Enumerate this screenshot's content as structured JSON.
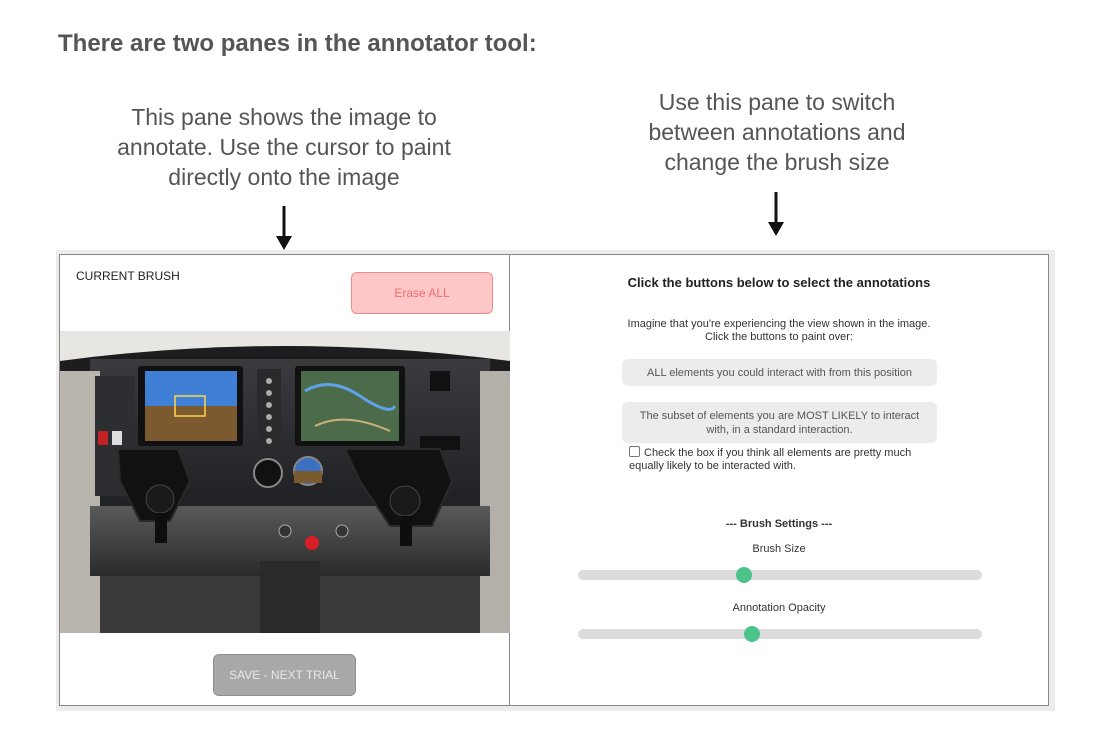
{
  "heading": "There are two panes in the annotator tool:",
  "captions": {
    "left": "This pane shows the image to\nannotate. Use the cursor to paint\ndirectly onto the image",
    "right": "Use this pane to switch\nbetween annotations and\nchange the brush size"
  },
  "left_pane": {
    "brush_label": "CURRENT BRUSH",
    "erase_label": "Erase ALL",
    "save_label": "SAVE - NEXT TRIAL"
  },
  "right_pane": {
    "title": "Click the buttons below to select the annotations",
    "instruction": "Imagine that you're experiencing the view shown in the image.\nClick the buttons to paint over:",
    "button_all": "ALL elements you could interact with from this position",
    "button_likely": "The subset of elements you are MOST LIKELY to interact with, in a standard interaction.",
    "checkbox_text": "Check the box if you think all elements are pretty much equally likely to be interacted with.",
    "checkbox_checked": false,
    "brush_settings_heading": "--- Brush Settings ---",
    "brush_size_label": "Brush Size",
    "brush_size_value": 0.41,
    "opacity_label": "Annotation Opacity",
    "opacity_value": 0.43
  },
  "colors": {
    "erase_bg": "#ffc7c7",
    "erase_text": "#f06d6d",
    "save_bg": "#a8a8a8",
    "slider_knob": "#4cc38a"
  },
  "icons": [
    "down-arrow-icon",
    "cockpit-photo"
  ]
}
